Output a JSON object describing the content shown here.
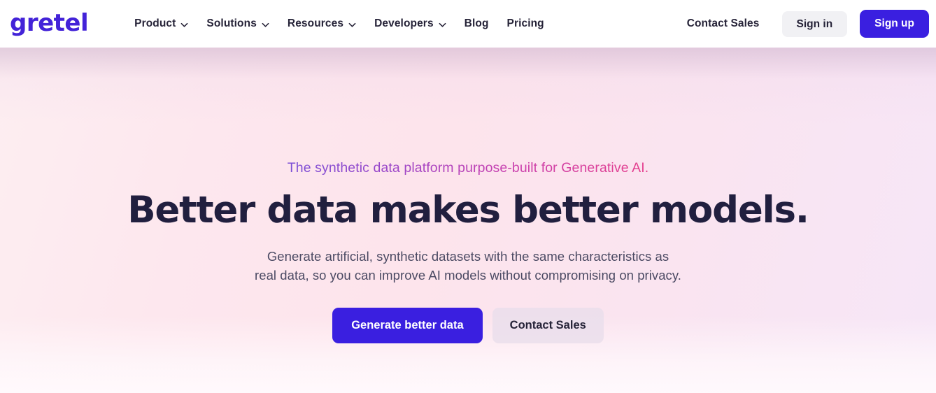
{
  "brand": {
    "logo_text": "gretel",
    "logo_color": "#4323d8"
  },
  "header": {
    "nav": [
      {
        "label": "Product",
        "has_dropdown": true,
        "icon": "chevron-down-icon"
      },
      {
        "label": "Solutions",
        "has_dropdown": true,
        "icon": "chevron-down-icon"
      },
      {
        "label": "Resources",
        "has_dropdown": true,
        "icon": "chevron-down-icon"
      },
      {
        "label": "Developers",
        "has_dropdown": true,
        "icon": "chevron-down-icon"
      },
      {
        "label": "Blog",
        "has_dropdown": false
      },
      {
        "label": "Pricing",
        "has_dropdown": false
      }
    ],
    "contact_sales": "Contact Sales",
    "sign_in": "Sign in",
    "sign_up": "Sign up",
    "sign_up_color": "#3a1fe0",
    "sign_in_bg": "#f1f1f4"
  },
  "hero": {
    "eyebrow": "The synthetic data platform purpose-built for Generative AI.",
    "eyebrow_gradient_start": "#7b4fd6",
    "eyebrow_gradient_end": "#e53f8c",
    "headline": "Better data makes better models.",
    "headline_color": "#211f3f",
    "subhead_line1": "Generate artificial, synthetic datasets with the same characteristics as",
    "subhead_line2": "real data, so you can improve AI models without compromising on privacy.",
    "cta_primary": "Generate better data",
    "cta_secondary": "Contact Sales",
    "background_start": "#fdeef1",
    "background_end": "#f6e6f7"
  }
}
